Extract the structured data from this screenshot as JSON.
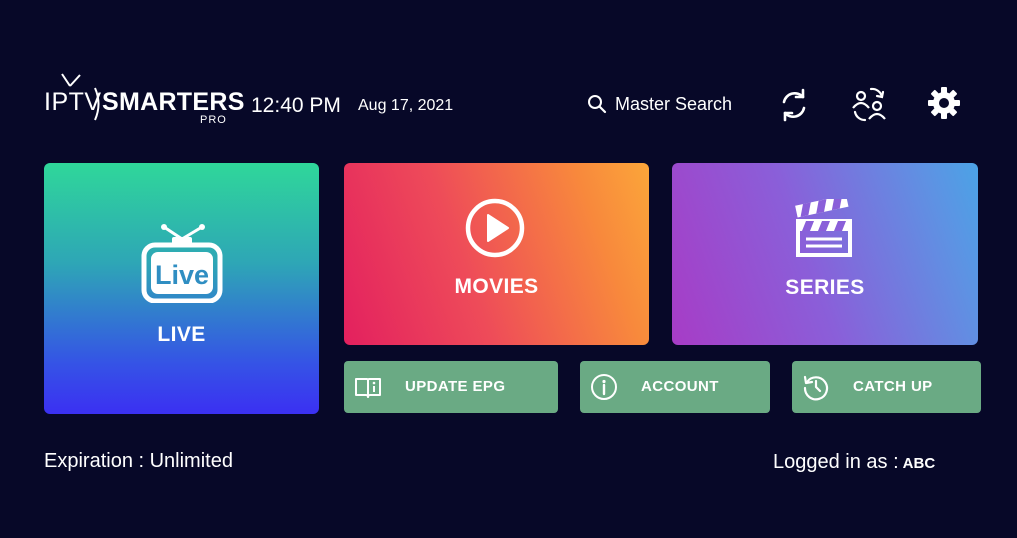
{
  "header": {
    "logo": {
      "iptv": "IPTV",
      "smarters": "SMARTERS",
      "pro": "PRO"
    },
    "time": "12:40 PM",
    "date": "Aug 17, 2021",
    "search_label": "Master Search",
    "icons": [
      "refresh-icon",
      "switch-user-icon",
      "gear-icon"
    ]
  },
  "tiles": {
    "live": {
      "label": "LIVE",
      "badge_text": "Live",
      "icon": "tv-icon"
    },
    "movies": {
      "label": "MOVIES",
      "icon": "play-icon"
    },
    "series": {
      "label": "SERIES",
      "icon": "clapperboard-icon"
    }
  },
  "buttons": {
    "update_epg": {
      "label": "UPDATE EPG",
      "icon": "book-icon"
    },
    "account": {
      "label": "ACCOUNT",
      "icon": "info-icon"
    },
    "catch_up": {
      "label": "CATCH UP",
      "icon": "history-icon"
    }
  },
  "footer": {
    "expiration": "Expiration : Unlimited",
    "logged_in_label": "Logged in as :",
    "username": "ABC"
  },
  "colors": {
    "background": "#070828",
    "button_green": "#6aaa84"
  }
}
